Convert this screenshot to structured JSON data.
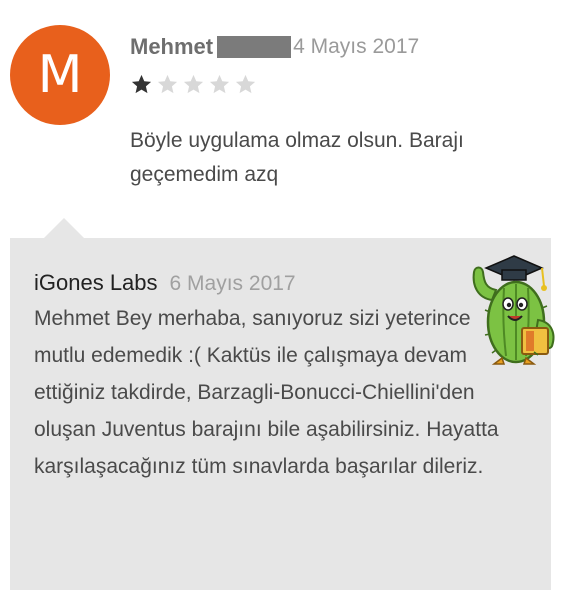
{
  "review": {
    "avatar_letter": "M",
    "avatar_color": "#e8601c",
    "author": "Mehmet",
    "date": "4 Mayıs 2017",
    "rating": 1,
    "max_rating": 5,
    "text": "Böyle uygulama olmaz olsun. Barajı geçemedim azq"
  },
  "reply": {
    "developer": "iGones Labs",
    "date": "6 Mayıs 2017",
    "text": "Mehmet Bey merhaba, sanıyoruz sizi yeterince mutlu edemedik :( Kaktüs ile çalışmaya devam ettiğiniz takdirde, Barzagli-Bonucci-Chiellini'den oluşan Juventus barajını bile aşabilirsiniz. Hayatta karşılaşacağınız tüm sınavlarda başarılar dileriz.",
    "mascot_icon": "cactus-graduate-icon"
  },
  "colors": {
    "star_filled": "#333333",
    "star_empty": "#d8d8d8",
    "reply_bg": "#e6e6e6"
  }
}
